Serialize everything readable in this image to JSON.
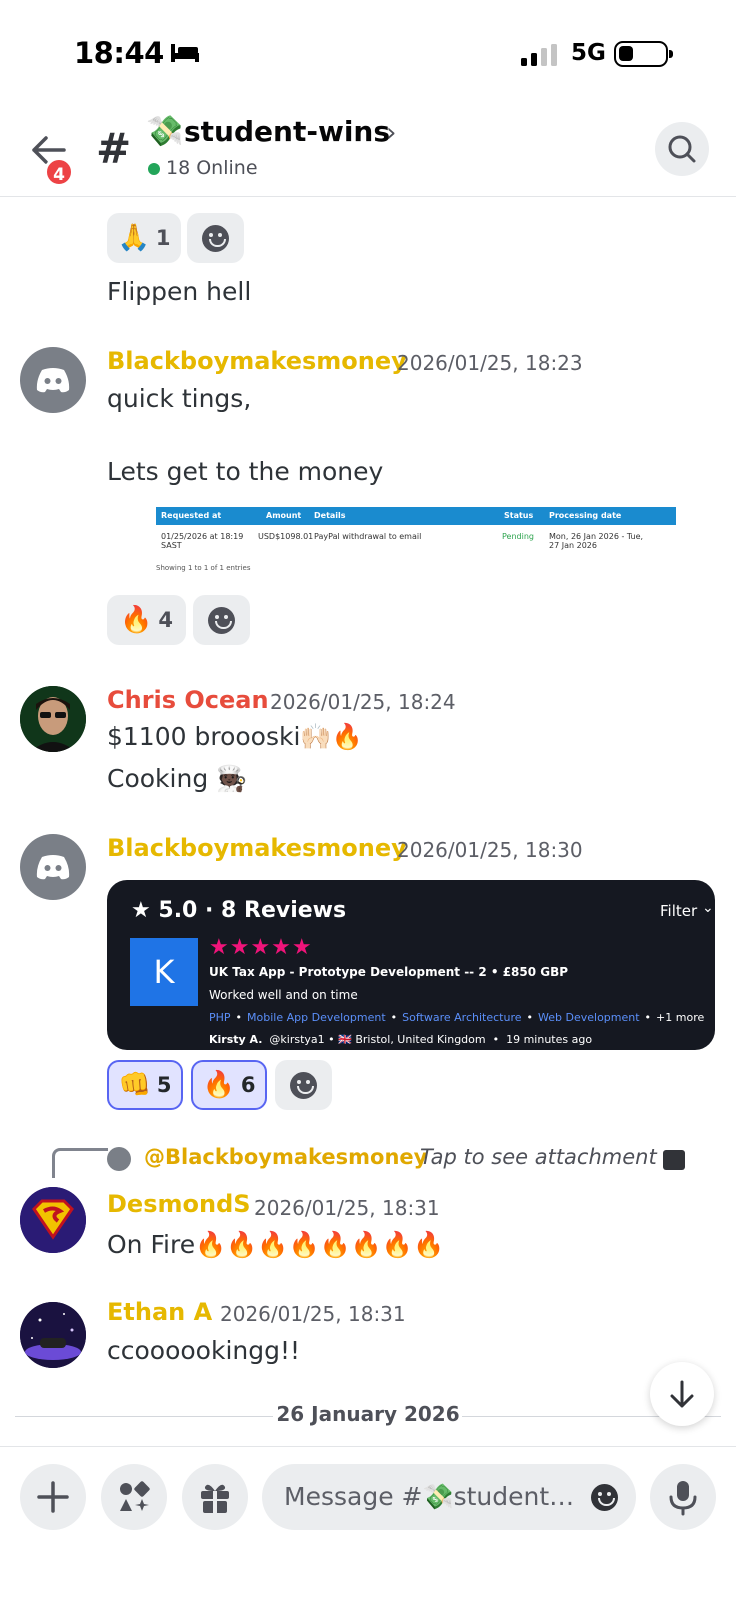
{
  "status_bar": {
    "time": "18:44",
    "network": "5G",
    "icons": [
      "bed-icon",
      "signal-icon",
      "battery-icon"
    ]
  },
  "header": {
    "unread_badge": "4",
    "channel_emoji": "💸",
    "channel_name": "student-wins",
    "chevron": "›",
    "online_text": "18 Online"
  },
  "top_message": {
    "reactions": [
      {
        "emoji": "🙏",
        "count": "1"
      }
    ],
    "text": "Flippen hell"
  },
  "messages": [
    {
      "user": "Blackboymakesmoney",
      "time": "2026/01/25, 18:23",
      "line1": "quick tings,",
      "line2": "Lets get to the money",
      "attachment": {
        "headers": [
          "Requested at",
          "Amount",
          "Details",
          "Status",
          "Processing date"
        ],
        "row": [
          "01/25/2026 at 18:19 SAST",
          "USD$1098.01",
          "PayPal withdrawal to email",
          "Pending",
          "Mon, 26 Jan 2026 - Tue, 27 Jan 2026"
        ],
        "footer": "Showing 1 to 1 of 1 entries"
      },
      "reactions": [
        {
          "emoji": "🔥",
          "count": "4"
        }
      ]
    },
    {
      "user": "Chris Ocean",
      "time": "2026/01/25, 18:24",
      "line1": "$1100 broooski🙌🏻🔥",
      "line2": "Cooking 🧑🏿‍🍳"
    },
    {
      "user": "Blackboymakesmoney",
      "time": "2026/01/25, 18:30",
      "review": {
        "title": "★ 5.0 · 8 Reviews",
        "filter": "Filter",
        "filter_chevron": "⌄",
        "avatar_letter": "K",
        "stars": "★★★★★",
        "job": "UK Tax App - Prototype Development -- 2  •  £850 GBP",
        "comment": "Worked well and on time",
        "tags": [
          "PHP",
          "Mobile App Development",
          "Software Architecture",
          "Web Development"
        ],
        "more": "+1 more",
        "author": "Kirsty A.",
        "handle": "@kirstya1",
        "flag": "🇬🇧",
        "location": "Bristol, United Kingdom",
        "age": "19 minutes ago"
      },
      "reactions": [
        {
          "emoji": "👊",
          "count": "5"
        },
        {
          "emoji": "🔥",
          "count": "6"
        }
      ]
    },
    {
      "reply_to": "@Blackboymakesmoney",
      "reply_text": "Tap to see attachment",
      "user": "DesmondS",
      "time": "2026/01/25, 18:31",
      "line1": "On Fire🔥🔥🔥🔥🔥🔥🔥🔥"
    },
    {
      "user": "Ethan A",
      "time": "2026/01/25, 18:31",
      "line1": "ccoooookingg!!"
    }
  ],
  "date_divider": "26 January 2026",
  "composer": {
    "placeholder": "Message #💸student-wins"
  },
  "colors": {
    "gold_user": "#e6b800",
    "red_user": "#e74c3c",
    "accent": "#5865f2",
    "online": "#23a55a",
    "badge": "#ed4245"
  }
}
